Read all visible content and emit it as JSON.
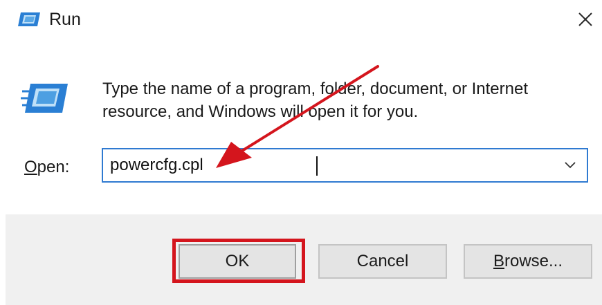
{
  "window": {
    "title": "Run",
    "close_glyph": "✕"
  },
  "description": {
    "line1": "Type the name of a program, folder, document, or Internet",
    "line2": "resource, and Windows will open it for you."
  },
  "open_field": {
    "label_mnemonic": "O",
    "label_rest": "pen:",
    "value": "powercfg.cpl"
  },
  "buttons": {
    "ok_label": "OK",
    "cancel_label": "Cancel",
    "browse_mnemonic": "B",
    "browse_rest": "rowse..."
  },
  "icons": {
    "title": "run-icon",
    "main": "run-icon-large",
    "close": "close-icon",
    "dropdown": "chevron-down-icon"
  },
  "colors": {
    "accent_border": "#2f7ad1",
    "annotation_red": "#d4151d",
    "footer_bg": "#f0f0f0",
    "button_bg": "#e4e4e4"
  }
}
